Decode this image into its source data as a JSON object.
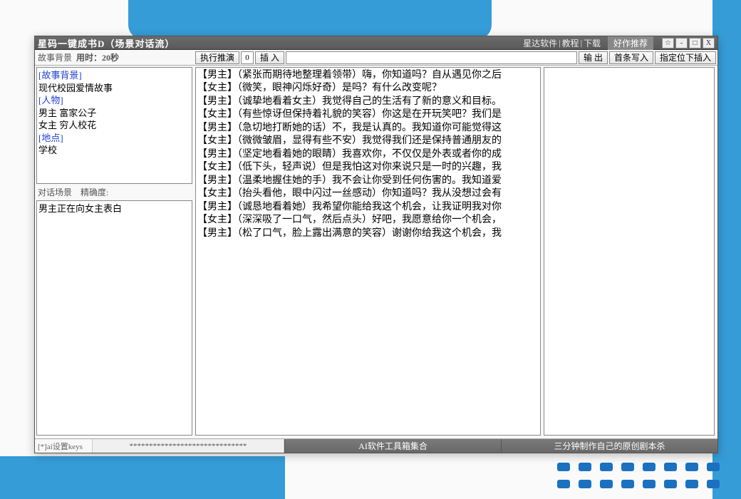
{
  "titlebar": {
    "title": "星码一键成书D（场景对话流）",
    "links": [
      "星达软件",
      "教程",
      "下载"
    ],
    "recommend": "好作推荐",
    "btns": {
      "star": "☆",
      "min": "-",
      "max": "□",
      "close": "X"
    }
  },
  "top": {
    "story_bg_label": "故事背景",
    "time_label": "用时：",
    "time_value": "20秒",
    "exec_btn": "执行推演",
    "counter": "0",
    "insert_btn": "插 入",
    "output_btn": "输 出",
    "first_write_btn": "首条写入",
    "insert_at_btn": "指定位下插入"
  },
  "left": {
    "story_bg_lines": [
      "[故事背景]",
      "现代校园爱情故事",
      "[人物]",
      "男主 富家公子",
      "女主 穷人校花",
      "[地点]",
      "学校"
    ],
    "scene_label": "对话场景",
    "accuracy_label": "精确度:",
    "scene_text": "男主正在向女主表白"
  },
  "dialogue": [
    "【男主】（紧张而期待地整理着领带）嗨，你知道吗？自从遇见你之后",
    "【女主】（微笑，眼神闪烁好奇）是吗？有什么改变呢？",
    "【男主】（诚挚地看着女主）我觉得自己的生活有了新的意义和目标。",
    "【女主】（有些惊讶但保持着礼貌的笑容）你这是在开玩笑吧？我们是",
    "【男主】（急切地打断她的话）不，我是认真的。我知道你可能觉得这",
    "【女主】（微微皱眉，显得有些不安）我觉得我们还是保持普通朋友的",
    "【男主】（坚定地看着她的眼睛）我喜欢你，不仅仅是外表或者你的成",
    "【女主】（低下头，轻声说）但是我怕这对你来说只是一时的兴趣，我",
    "【男主】（温柔地握住她的手）我不会让你受到任何伤害的。我知道爱",
    "【女主】（抬头看他，眼中闪过一丝感动）你知道吗？我从没想过会有",
    "【男主】（诚恳地看着她）我希望你能给我这个机会，让我证明我对你",
    "【女主】（深深吸了一口气，然后点头）好吧，我愿意给你一个机会，",
    "【男主】（松了口气，脸上露出满意的笑容）谢谢你给我这个机会，我"
  ],
  "footer": {
    "keys": "[*]ai设置keys",
    "stars": "******************************",
    "tool_btn": "AI软件工具箱集合",
    "script_btn": "三分钟制作自己的原创剧本杀"
  }
}
